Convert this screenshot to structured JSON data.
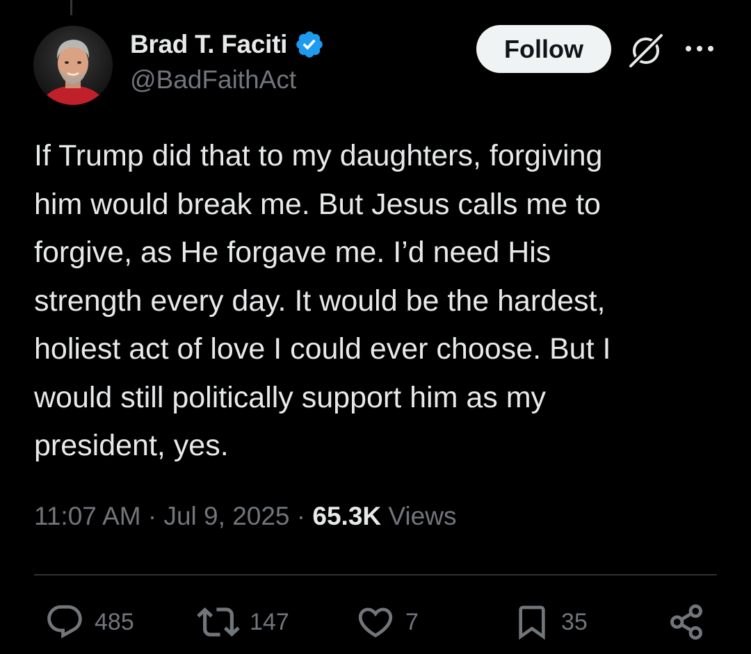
{
  "author": {
    "display_name": "Brad T. Faciti",
    "handle": "@BadFaithAct",
    "verified": true,
    "verified_color": "#1d9bf0"
  },
  "header": {
    "follow_label": "Follow",
    "grok_icon": "grok-icon",
    "more_icon": "more-dots-icon"
  },
  "tweet": {
    "text": "If Trump did that to my daughters, forgiving\nhim would break me. But Jesus calls me to\nforgive, as He forgave me. I’d need His\nstrength every day. It would be the hardest,\nholiest act of love I could ever choose. But I\nwould still politically support him as my\npresident, yes."
  },
  "meta": {
    "time": "11:07 AM",
    "separator": "·",
    "date": "Jul 9, 2025",
    "views_count": "65.3K",
    "views_label": "Views"
  },
  "actions": {
    "replies": "485",
    "reposts": "147",
    "likes": "7",
    "bookmarks": "35"
  },
  "colors": {
    "background": "#000000",
    "text_primary": "#e7e9ea",
    "text_secondary": "#71767b",
    "divider": "#2f3336"
  }
}
